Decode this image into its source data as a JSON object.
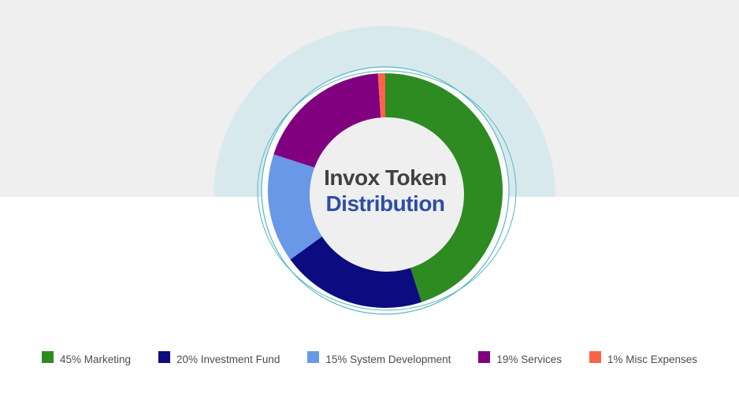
{
  "page": {
    "top_band_color": "#efeff0",
    "lower_background": "#ffffff"
  },
  "chart": {
    "center_title_line1": "Invox Token",
    "center_title_line2": "Distribution",
    "center_title_line1_color": "#3f4145",
    "center_title_line2_color": "#2d4ea6",
    "halo_color": "#d8e9ed",
    "ring_stroke_color": "#58b8c4",
    "backing_disc_color": "#fbfcfc",
    "center_disc_color": "#efeff0"
  },
  "chart_data": {
    "type": "pie",
    "donut": true,
    "title": "Invox Token Distribution",
    "start_angle_deg_from_top": 0,
    "direction": "clockwise",
    "legend_position": "bottom",
    "segments": [
      {
        "label": "Marketing",
        "percent": 45,
        "color": "#2d8b21",
        "legend": "45% Marketing"
      },
      {
        "label": "Investment Fund",
        "percent": 20,
        "color": "#0c0c80",
        "legend": "20% Investment Fund"
      },
      {
        "label": "System Development",
        "percent": 15,
        "color": "#6a98e9",
        "legend": "15% System Development"
      },
      {
        "label": "Services",
        "percent": 19,
        "color": "#800080",
        "legend": "19% Services"
      },
      {
        "label": "Misc Expenses",
        "percent": 1,
        "color": "#fb6448",
        "legend": "1% Misc Expenses"
      }
    ]
  }
}
